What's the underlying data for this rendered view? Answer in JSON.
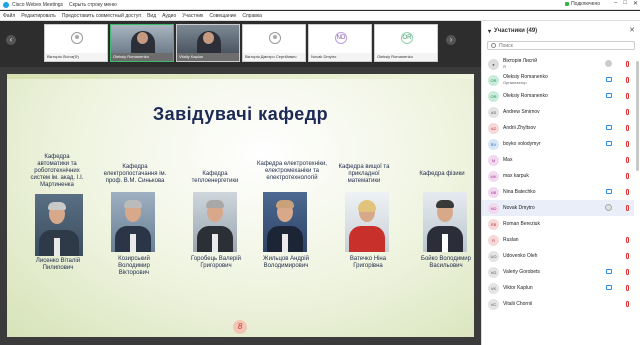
{
  "window": {
    "title": "Cisco Webex Meetings",
    "hide_menu": "Скрыть строку меню",
    "connection": "Подключено"
  },
  "menu": [
    "Файл",
    "Редактировать",
    "Предоставить совместный доступ",
    "Вид",
    "Аудио",
    "Участник",
    "Совещание",
    "Справка"
  ],
  "strip": {
    "tiles": [
      {
        "label": "Вікторія Лісіта(Ф)",
        "kind": "avatar",
        "initials": ""
      },
      {
        "label": "Oleksiy Romanenko",
        "kind": "video",
        "initials": ""
      },
      {
        "label": "Vitaliy Kaplun",
        "kind": "video",
        "initials": ""
      },
      {
        "label": "Вікторія Дмитро Сергійович",
        "kind": "avatar",
        "initials": ""
      },
      {
        "label": "Novak Dmytro",
        "kind": "initials",
        "initials": "ND"
      },
      {
        "label": "Oleksiy Romanenko",
        "kind": "initials",
        "initials": "OR"
      }
    ]
  },
  "slide": {
    "title": "Завідувачі кафедр",
    "page_marker": "8",
    "departments": [
      {
        "dept": "Кафедра автоматики та робототехнічних систем ім. акад. І.І. Мартиненка",
        "name": "Лисенко Віталій Пилипович"
      },
      {
        "dept": "Кафедра електропостачання ім. проф. В.М. Синькова",
        "name": "Козирський Володимир Вікторович"
      },
      {
        "dept": "Кафедра теплоенергетики",
        "name": "Горобець Валерій Григорович"
      },
      {
        "dept": "Кафедра електротехніки, електромеханіки та електротехнологій",
        "name": "Жильцов Андрій Володимирович"
      },
      {
        "dept": "Кафедра вищої та прикладної математики",
        "name": "Ватечко Ніна Григорівна"
      },
      {
        "dept": "Кафедра фізики",
        "name": "Бойко Володимир Васильович"
      }
    ]
  },
  "panel": {
    "title": "Участники (49)",
    "search_placeholder": "Поиск",
    "participants": [
      {
        "name": "Вікторія Лисгій",
        "sub": "Я",
        "initials": "",
        "color": "#dddddd",
        "text_color": "#555555"
      },
      {
        "name": "Oleksiy Romanenko",
        "sub": "Организатор",
        "initials": "OR",
        "color": "#c9ecd9",
        "text_color": "#2b8a5a"
      },
      {
        "name": "Oleksiy Romanenko",
        "sub": "",
        "initials": "OR",
        "color": "#c9ecd9",
        "text_color": "#2b8a5a"
      },
      {
        "name": "Andrew Smirnov",
        "sub": "",
        "initials": "AS",
        "color": "#e4e4e4",
        "text_color": "#555555"
      },
      {
        "name": "Andrii Zhyltsov",
        "sub": "",
        "initials": "AZ",
        "color": "#f7d8d8",
        "text_color": "#b33a3a"
      },
      {
        "name": "boyko volodymyr",
        "sub": "",
        "initials": "BV",
        "color": "#d7e6f7",
        "text_color": "#2f6db3"
      },
      {
        "name": "Max",
        "sub": "",
        "initials": "M",
        "color": "#f3d9ef",
        "text_color": "#a33a93"
      },
      {
        "name": "max karpuk",
        "sub": "",
        "initials": "MK",
        "color": "#f3d9ef",
        "text_color": "#a33a93"
      },
      {
        "name": "Nina Batechko",
        "sub": "",
        "initials": "NB",
        "color": "#f3d9ef",
        "text_color": "#a33a93"
      },
      {
        "name": "Novak Dmytro",
        "sub": "",
        "initials": "ND",
        "color": "#f3d9ef",
        "text_color": "#a33a93"
      },
      {
        "name": "Roman Bereziuk",
        "sub": "",
        "initials": "RB",
        "color": "#f7d8d8",
        "text_color": "#b33a3a"
      },
      {
        "name": "Ruslan",
        "sub": "",
        "initials": "R",
        "color": "#f7d8d8",
        "text_color": "#b33a3a"
      },
      {
        "name": "Udovenko Olеh",
        "sub": "",
        "initials": "UO",
        "color": "#e4e4e4",
        "text_color": "#555555"
      },
      {
        "name": "Valeriy Gorobets",
        "sub": "",
        "initials": "VG",
        "color": "#e4e4e4",
        "text_color": "#555555"
      },
      {
        "name": "Viktor Kaplun",
        "sub": "",
        "initials": "VK",
        "color": "#e4e4e4",
        "text_color": "#555555"
      },
      {
        "name": "Vitalii Chornii",
        "sub": "",
        "initials": "VC",
        "color": "#e4e4e4",
        "text_color": "#555555"
      }
    ]
  }
}
